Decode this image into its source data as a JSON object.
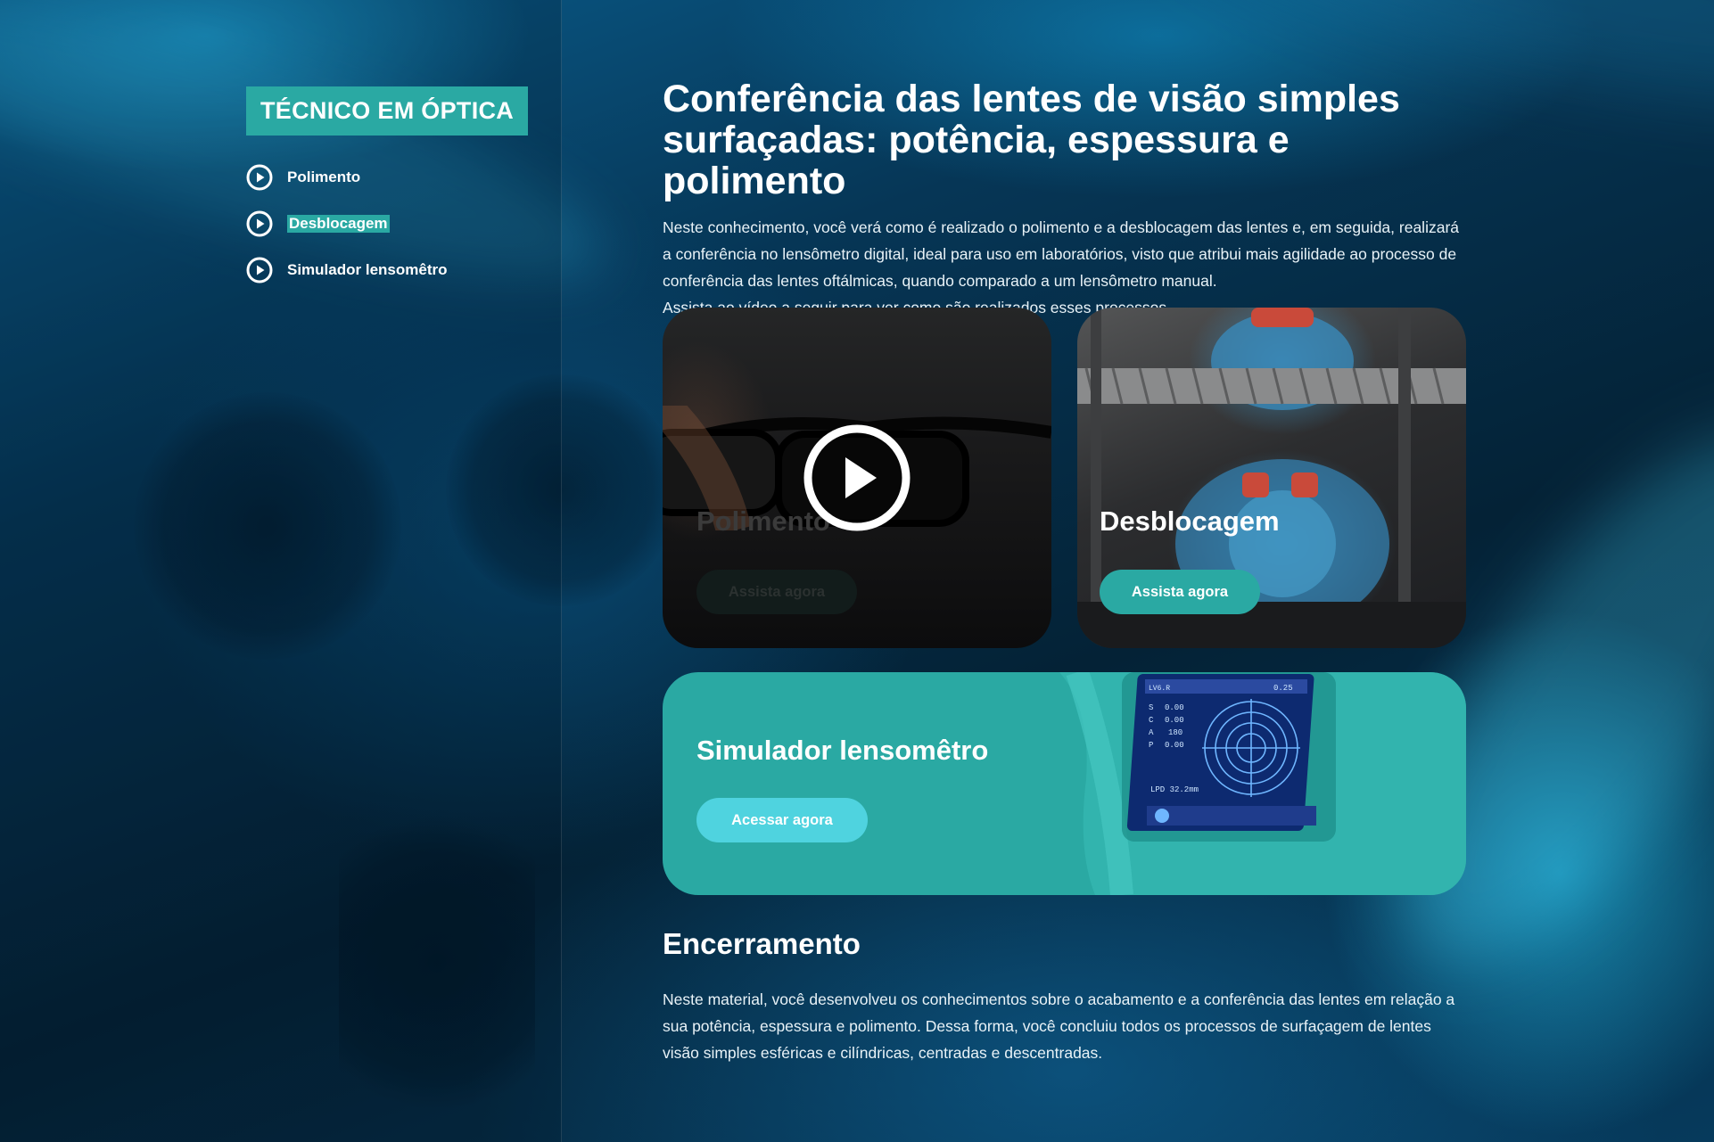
{
  "sidebar": {
    "course_title": "TÉCNICO EM ÓPTICA",
    "items": [
      {
        "label": "Polimento",
        "icon": "play-circle-icon",
        "active": false
      },
      {
        "label": "Desblocagem",
        "icon": "play-circle-icon",
        "active": true
      },
      {
        "label": "Simulador lensomêtro",
        "icon": "play-circle-icon",
        "active": false
      }
    ]
  },
  "main": {
    "title": "Conferência das lentes de visão simples surfaçadas: potência, espessura e polimento",
    "intro": [
      "Neste conhecimento, você verá como é realizado o polimento e a desblocagem das lentes e, em seguida, realizará a conferência no lensômetro digital, ideal para uso em laboratórios, visto que atribui mais agilidade ao processo de conferência das lentes oftálmicas, quando comparado a um lensômetro manual.",
      "Assista ao vídeo a seguir para ver como são realizados esses processos."
    ],
    "cards": [
      {
        "title": "Polimento",
        "button": "Assista agora",
        "icon": "play-icon"
      },
      {
        "title": "Desblocagem",
        "button": "Assista agora"
      }
    ],
    "simulator": {
      "title": "Simulador lensomêtro",
      "button": "Acessar agora",
      "screen": {
        "s": "S",
        "s_val": "0.00",
        "c": "C",
        "c_val": "0.00",
        "a": "A",
        "a_val": "180",
        "p": "P",
        "p_val": "0.00",
        "top_left": "LV6.R",
        "top_right": "0.25",
        "lpd": "LPD 32.2mm"
      }
    },
    "closing": {
      "title": "Encerramento",
      "text": "Neste material, você desenvolveu os conhecimentos sobre o acabamento e a conferência das lentes em relação a sua potência, espessura e polimento. Dessa forma, você concluiu todos os processos de surfaçagem de lentes visão simples esféricas e cilíndricas, centradas e descentradas."
    }
  },
  "colors": {
    "accent_teal": "#2aa9a3",
    "button_light": "#4fd3df",
    "background_dark": "#041a2a"
  }
}
